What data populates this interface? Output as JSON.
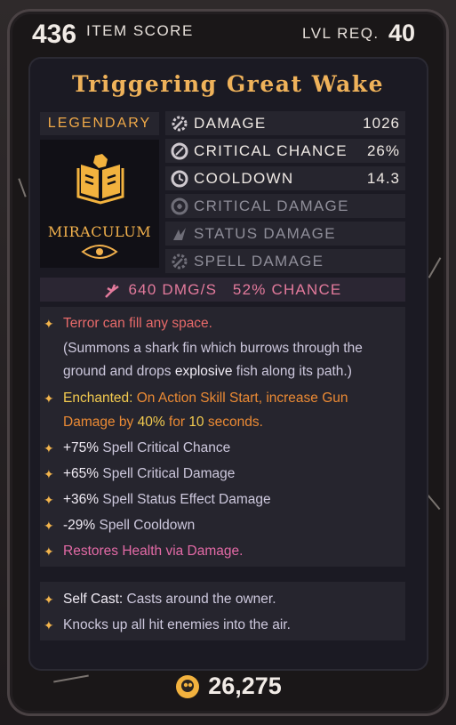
{
  "header": {
    "item_score": "436",
    "item_score_label": "ITEM SCORE",
    "level_label": "LVL REQ.",
    "level": "40"
  },
  "item": {
    "name": "Triggering Great Wake",
    "rarity": "LEGENDARY",
    "brand": "MIRACULUM",
    "icon": "spellbook-icon"
  },
  "stats": [
    {
      "name": "DAMAGE",
      "value": "1026",
      "icon": "damage-gear-icon"
    },
    {
      "name": "CRITICAL CHANCE",
      "value": "26%",
      "icon": "crit-chance-icon"
    },
    {
      "name": "COOLDOWN",
      "value": "14.3",
      "icon": "cooldown-icon"
    },
    {
      "name": "CRITICAL DAMAGE",
      "value": "",
      "icon": "crit-damage-icon"
    },
    {
      "name": "STATUS DAMAGE",
      "value": "",
      "icon": "status-damage-icon"
    },
    {
      "name": "SPELL DAMAGE",
      "value": "",
      "icon": "spell-damage-icon"
    }
  ],
  "dps": {
    "text": "640 DMG/S",
    "chance": "52% CHANCE"
  },
  "lines": {
    "flavor": "Terror can fill any space.",
    "desc1": "(Summons a shark fin which burrows through the",
    "desc2a": "ground and drops ",
    "desc2b": "explosive",
    "desc2c": " fish along its path.)",
    "ench_label": "Enchanted:",
    "ench1": " On Action Skill Start, increase Gun",
    "ench2a": "Damage by ",
    "ench2b": "40%",
    "ench2c": " for ",
    "ench2d": "10",
    "ench2e": " seconds.",
    "m1a": "+75%",
    "m1b": " Spell Critical Chance",
    "m2a": "+65%",
    "m2b": " Spell Critical Damage",
    "m3a": "+36%",
    "m3b": " Spell Status Effect Damage",
    "m4a": "-29%",
    "m4b": " Spell Cooldown",
    "heal": "Restores Health via Damage.",
    "self_label": "Self Cast:",
    "self_text": " Casts around the owner.",
    "knock": "Knocks up all hit enemies into the air."
  },
  "price": {
    "value": "26,275",
    "icon": "gold-coin-icon"
  },
  "colors": {
    "legendary": "#efb25a",
    "red_text": "#e86a6a",
    "pink_text": "#e36aa6",
    "orange_text": "#eb8a34"
  }
}
